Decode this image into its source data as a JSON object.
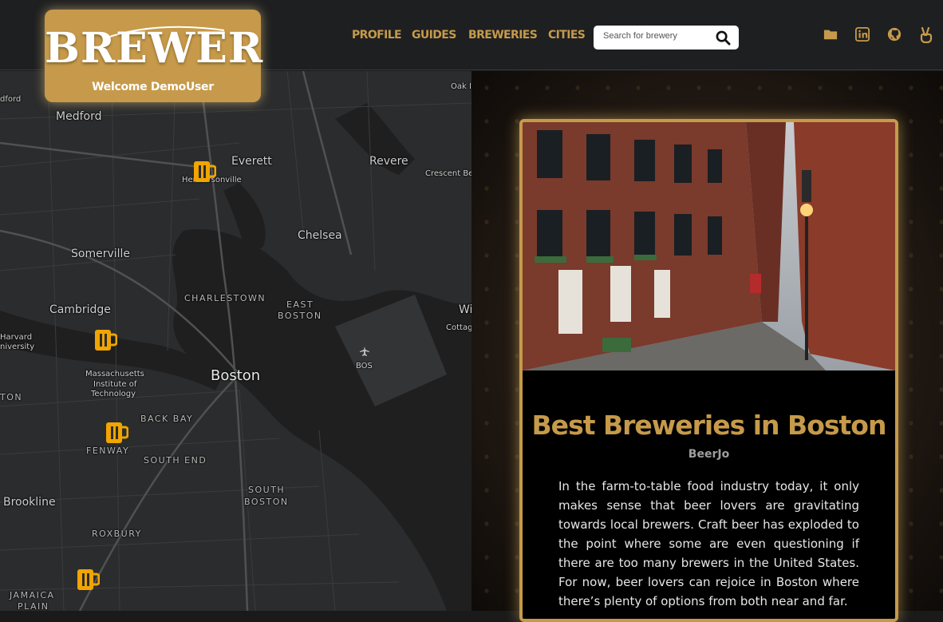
{
  "brand": {
    "name": "BREWER",
    "welcome": "Welcome DemoUser",
    "accent": "#c69a4a"
  },
  "nav": {
    "links": [
      "PROFILE",
      "GUIDES",
      "BREWERIES",
      "CITIES"
    ],
    "search_placeholder": "Search for brewery"
  },
  "social_icons": [
    "folder-icon",
    "linkedin-icon",
    "github-icon",
    "peace-hand-icon"
  ],
  "map": {
    "labels": {
      "medford_edge": "dford",
      "medford": "Medford",
      "everett": "Everett",
      "hendersonville": "Hendersonville",
      "revere": "Revere",
      "oak_island": "Oak Is",
      "crescent_beach": "Crescent Bea",
      "chelsea": "Chelsea",
      "somerville": "Somerville",
      "charlestown": "CHARLESTOWN",
      "east_boston_1": "EAST",
      "east_boston_2": "BOSTON",
      "cambridge": "Cambridge",
      "harvard_1": "Harvard",
      "harvard_2": "niversity",
      "winthrop": "Wi",
      "cottage": "Cottag",
      "bos": "BOS",
      "boston": "Boston",
      "mit_1": "Massachusetts",
      "mit_2": "Institute of",
      "mit_3": "Technology",
      "ton": "TON",
      "back_bay": "BACK BAY",
      "fenway": "FENWAY",
      "south_end": "SOUTH END",
      "south_boston_1": "SOUTH",
      "south_boston_2": "BOSTON",
      "brookline": "Brookline",
      "roxbury": "ROXBURY",
      "jamaica_1": "JAMAICA",
      "jamaica_2": "PLAIN"
    },
    "pins": [
      "brewery-pin",
      "brewery-pin",
      "brewery-pin",
      "brewery-pin"
    ]
  },
  "article": {
    "title": "Best Breweries in Boston",
    "author": "BeerJo",
    "body": "In the farm-to-table food industry today, it only makes sense that beer lovers are gravitating towards local brewers. Craft beer has exploded to the point where some are even questioning if there are too many brewers in the United States. For now, beer lovers can rejoice in Boston where there’s plenty of options from both near and far."
  }
}
